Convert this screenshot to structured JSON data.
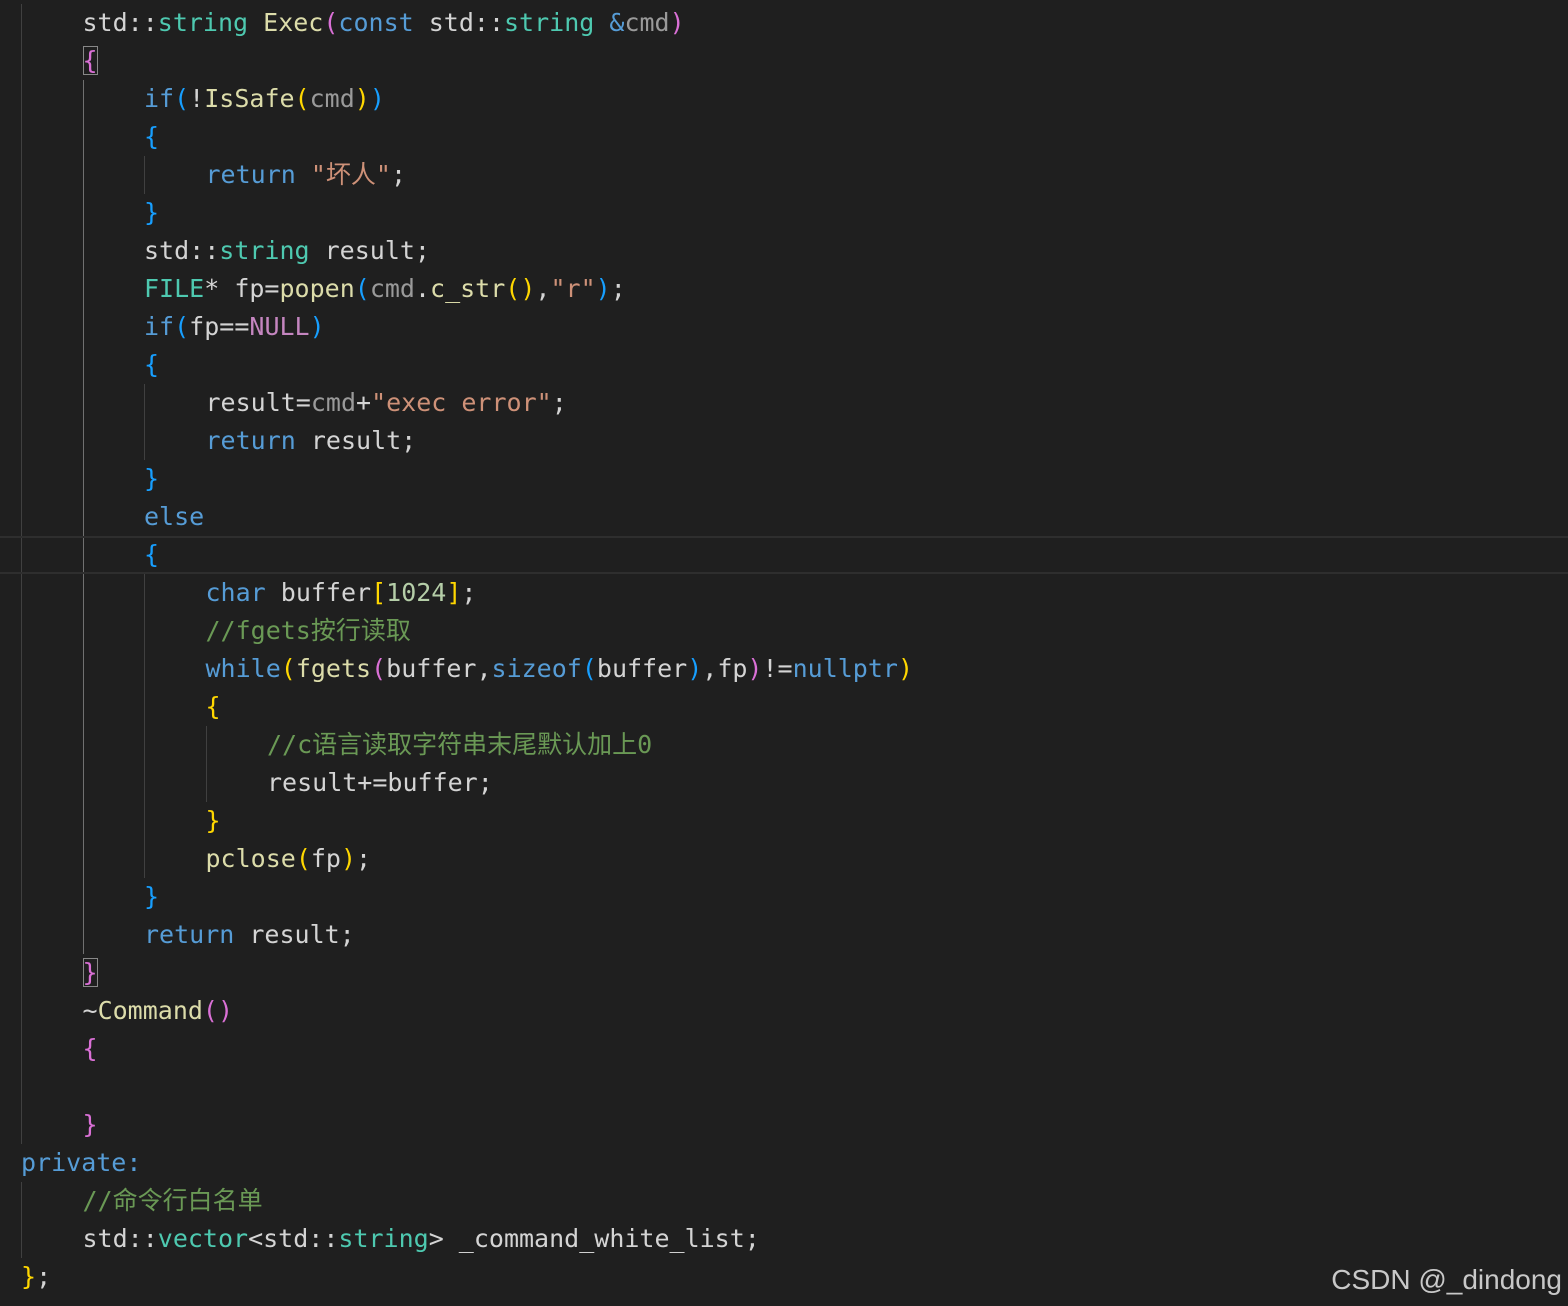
{
  "editor": {
    "theme_colors": {
      "background": "#1f1f1f",
      "keyword": "#569cd6",
      "type": "#4ec9b0",
      "function": "#dcdcaa",
      "string": "#ce9178",
      "number": "#b5cea8",
      "comment": "#6a9955",
      "bracket_level_1": "#ffd700",
      "bracket_level_2": "#da70d6",
      "bracket_level_3": "#179fff"
    },
    "current_line": 14,
    "lines": [
      {
        "indent": 1,
        "tokens": [
          {
            "t": "std::",
            "c": "plain"
          },
          {
            "t": "string",
            "c": "type"
          },
          {
            "t": " ",
            "c": "plain"
          },
          {
            "t": "Exec",
            "c": "fn"
          },
          {
            "t": "(",
            "c": "b2"
          },
          {
            "t": "const",
            "c": "kw"
          },
          {
            "t": " std::",
            "c": "plain"
          },
          {
            "t": "string",
            "c": "type"
          },
          {
            "t": " ",
            "c": "plain"
          },
          {
            "t": "&",
            "c": "kw"
          },
          {
            "t": "cmd",
            "c": "param"
          },
          {
            "t": ")",
            "c": "b2"
          }
        ]
      },
      {
        "indent": 1,
        "tokens": [
          {
            "t": "{",
            "c": "b2",
            "m": true
          }
        ]
      },
      {
        "indent": 2,
        "tokens": [
          {
            "t": "if",
            "c": "kw"
          },
          {
            "t": "(",
            "c": "b3"
          },
          {
            "t": "!",
            "c": "plain"
          },
          {
            "t": "IsSafe",
            "c": "fn"
          },
          {
            "t": "(",
            "c": "b1"
          },
          {
            "t": "cmd",
            "c": "param"
          },
          {
            "t": ")",
            "c": "b1"
          },
          {
            "t": ")",
            "c": "b3"
          }
        ]
      },
      {
        "indent": 2,
        "tokens": [
          {
            "t": "{",
            "c": "b3"
          }
        ]
      },
      {
        "indent": 3,
        "tokens": [
          {
            "t": "return",
            "c": "kw"
          },
          {
            "t": " ",
            "c": "plain"
          },
          {
            "t": "\"坏人\"",
            "c": "str"
          },
          {
            "t": ";",
            "c": "plain"
          }
        ]
      },
      {
        "indent": 2,
        "tokens": [
          {
            "t": "}",
            "c": "b3"
          }
        ]
      },
      {
        "indent": 2,
        "tokens": [
          {
            "t": "std::",
            "c": "plain"
          },
          {
            "t": "string",
            "c": "type"
          },
          {
            "t": " result;",
            "c": "plain"
          }
        ]
      },
      {
        "indent": 2,
        "tokens": [
          {
            "t": "FILE",
            "c": "type"
          },
          {
            "t": "* fp=",
            "c": "plain"
          },
          {
            "t": "popen",
            "c": "fn"
          },
          {
            "t": "(",
            "c": "b3"
          },
          {
            "t": "cmd",
            "c": "param"
          },
          {
            "t": ".",
            "c": "plain"
          },
          {
            "t": "c_str",
            "c": "fn"
          },
          {
            "t": "()",
            "c": "b1"
          },
          {
            "t": ",",
            "c": "plain"
          },
          {
            "t": "\"r\"",
            "c": "str"
          },
          {
            "t": ")",
            "c": "b3"
          },
          {
            "t": ";",
            "c": "plain"
          }
        ]
      },
      {
        "indent": 2,
        "tokens": [
          {
            "t": "if",
            "c": "kw"
          },
          {
            "t": "(",
            "c": "b3"
          },
          {
            "t": "fp==",
            "c": "plain"
          },
          {
            "t": "NULL",
            "c": "macro"
          },
          {
            "t": ")",
            "c": "b3"
          }
        ]
      },
      {
        "indent": 2,
        "tokens": [
          {
            "t": "{",
            "c": "b3"
          }
        ]
      },
      {
        "indent": 3,
        "tokens": [
          {
            "t": "result=",
            "c": "plain"
          },
          {
            "t": "cmd",
            "c": "param"
          },
          {
            "t": "+",
            "c": "plain"
          },
          {
            "t": "\"exec error\"",
            "c": "str"
          },
          {
            "t": ";",
            "c": "plain"
          }
        ]
      },
      {
        "indent": 3,
        "tokens": [
          {
            "t": "return",
            "c": "kw"
          },
          {
            "t": " result;",
            "c": "plain"
          }
        ]
      },
      {
        "indent": 2,
        "tokens": [
          {
            "t": "}",
            "c": "b3"
          }
        ]
      },
      {
        "indent": 2,
        "tokens": [
          {
            "t": "else",
            "c": "kw"
          }
        ]
      },
      {
        "indent": 2,
        "tokens": [
          {
            "t": "{",
            "c": "b3"
          }
        ]
      },
      {
        "indent": 3,
        "tokens": [
          {
            "t": "char",
            "c": "kw"
          },
          {
            "t": " buffer",
            "c": "plain"
          },
          {
            "t": "[",
            "c": "b1"
          },
          {
            "t": "1024",
            "c": "num"
          },
          {
            "t": "]",
            "c": "b1"
          },
          {
            "t": ";",
            "c": "plain"
          }
        ]
      },
      {
        "indent": 3,
        "tokens": [
          {
            "t": "//fgets按行读取",
            "c": "com"
          }
        ]
      },
      {
        "indent": 3,
        "tokens": [
          {
            "t": "while",
            "c": "kw"
          },
          {
            "t": "(",
            "c": "b1"
          },
          {
            "t": "fgets",
            "c": "fn"
          },
          {
            "t": "(",
            "c": "b2"
          },
          {
            "t": "buffer,",
            "c": "plain"
          },
          {
            "t": "sizeof",
            "c": "kw"
          },
          {
            "t": "(",
            "c": "b3"
          },
          {
            "t": "buffer",
            "c": "plain"
          },
          {
            "t": ")",
            "c": "b3"
          },
          {
            "t": ",fp",
            "c": "plain"
          },
          {
            "t": ")",
            "c": "b2"
          },
          {
            "t": "!=",
            "c": "plain"
          },
          {
            "t": "nullptr",
            "c": "kw"
          },
          {
            "t": ")",
            "c": "b1"
          }
        ]
      },
      {
        "indent": 3,
        "tokens": [
          {
            "t": "{",
            "c": "b1"
          }
        ]
      },
      {
        "indent": 4,
        "tokens": [
          {
            "t": "//c语言读取字符串末尾默认加上0",
            "c": "com"
          }
        ]
      },
      {
        "indent": 4,
        "tokens": [
          {
            "t": "result+=buffer;",
            "c": "plain"
          }
        ]
      },
      {
        "indent": 3,
        "tokens": [
          {
            "t": "}",
            "c": "b1"
          }
        ]
      },
      {
        "indent": 3,
        "tokens": [
          {
            "t": "pclose",
            "c": "fn"
          },
          {
            "t": "(",
            "c": "b1"
          },
          {
            "t": "fp",
            "c": "plain"
          },
          {
            "t": ")",
            "c": "b1"
          },
          {
            "t": ";",
            "c": "plain"
          }
        ]
      },
      {
        "indent": 2,
        "tokens": [
          {
            "t": "}",
            "c": "b3"
          }
        ]
      },
      {
        "indent": 2,
        "tokens": [
          {
            "t": "return",
            "c": "kw"
          },
          {
            "t": " result;",
            "c": "plain"
          }
        ]
      },
      {
        "indent": 1,
        "tokens": [
          {
            "t": "}",
            "c": "b2",
            "m": true
          }
        ]
      },
      {
        "indent": 1,
        "tokens": [
          {
            "t": "~",
            "c": "plain"
          },
          {
            "t": "Command",
            "c": "fn"
          },
          {
            "t": "()",
            "c": "b2"
          }
        ]
      },
      {
        "indent": 1,
        "tokens": [
          {
            "t": "{",
            "c": "b2"
          }
        ]
      },
      {
        "indent": 0,
        "tokens": []
      },
      {
        "indent": 1,
        "tokens": [
          {
            "t": "}",
            "c": "b2"
          }
        ]
      },
      {
        "indent": 0,
        "tokens": [
          {
            "t": "private:",
            "c": "kw"
          }
        ]
      },
      {
        "indent": 1,
        "tokens": [
          {
            "t": "//命令行白名单",
            "c": "com"
          }
        ]
      },
      {
        "indent": 1,
        "tokens": [
          {
            "t": "std::",
            "c": "plain"
          },
          {
            "t": "vector",
            "c": "type"
          },
          {
            "t": "<std::",
            "c": "plain"
          },
          {
            "t": "string",
            "c": "type"
          },
          {
            "t": "> _command_white_list;",
            "c": "plain"
          }
        ]
      },
      {
        "indent": 0,
        "tokens": [
          {
            "t": "}",
            "c": "b1"
          },
          {
            "t": ";",
            "c": "plain"
          }
        ]
      }
    ]
  },
  "watermark": {
    "text": "CSDN @_dindong"
  }
}
